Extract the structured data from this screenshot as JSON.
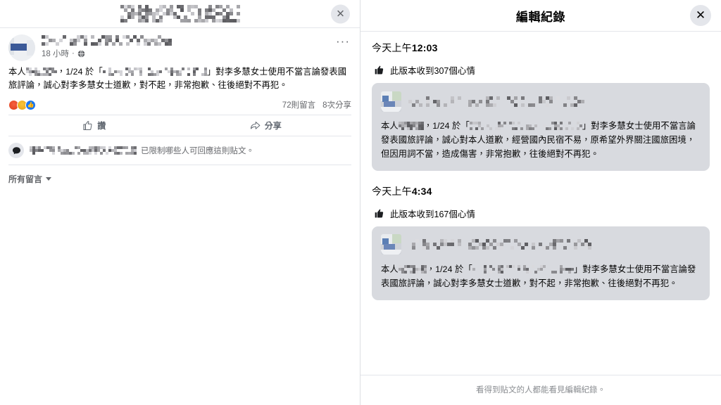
{
  "left_panel": {
    "dialog_title_redacted": true,
    "close_label": "✕",
    "post": {
      "author_redacted": true,
      "time_ago": "18 小時",
      "audience_icon": "globe-icon",
      "menu_label": "···",
      "text_part1": "本人",
      "text_part2": "，1/24 於「",
      "text_part3": "」對李多慧女士使用不當言論發表國旅評論，誠心對李多慧女士道歉，對不起，非常抱歉、往後絕對不再犯。",
      "reactions": [
        "angry",
        "haha",
        "like"
      ],
      "comments_count": "72則留言",
      "shares_count": "8次分享"
    },
    "actions": {
      "like_label": "讚",
      "like_icon": "thumbs-up-outline-icon",
      "share_label": "分享",
      "share_icon": "share-arrow-icon"
    },
    "comment_restriction": {
      "avatar_icon": "comment-bubble-icon",
      "name_redacted": true,
      "text": "已限制哪些人可回應這則貼文。"
    },
    "comments_filter": {
      "label": "所有留言",
      "caret_icon": "chevron-down-icon"
    }
  },
  "right_panel": {
    "title": "編輯紀錄",
    "close_label": "✕",
    "entries": [
      {
        "timestamp_label": "今天上午",
        "timestamp_time": "12:03",
        "reaction_icon": "thumbs-up-filled-icon",
        "reaction_text": "此版本收到307個心情",
        "reaction_count": "307",
        "card": {
          "author_redacted": true,
          "text_part1": "本人",
          "text_part2": "，1/24 於「",
          "text_part3": "」對李多慧女士使用不當言論發表國旅評論，誠心對本人道歉，經營國內民宿不易，原希望外界關注國旅困境，但因用詞不當，造成傷害，非常抱歉，往後絕對不再犯。"
        }
      },
      {
        "timestamp_label": "今天上午",
        "timestamp_time": "4:34",
        "reaction_icon": "thumbs-up-filled-icon",
        "reaction_text": "此版本收到167個心情",
        "reaction_count": "167",
        "card": {
          "author_redacted": true,
          "text_part1": "本人",
          "text_part2": "，1/24 於「",
          "text_part3": "」對李多慧女士使用不當言論發表國旅評論，誠心對李多慧女士道歉，對不起，非常抱歉、往後絕對不再犯。"
        }
      }
    ],
    "footer_note": "看得到貼文的人都能看見編輯紀錄。"
  },
  "colors": {
    "accent_blue": "#1877f2",
    "card_gray": "#d8dadf",
    "text_primary": "#050505",
    "text_secondary": "#65676b",
    "divider": "#e4e6eb"
  }
}
